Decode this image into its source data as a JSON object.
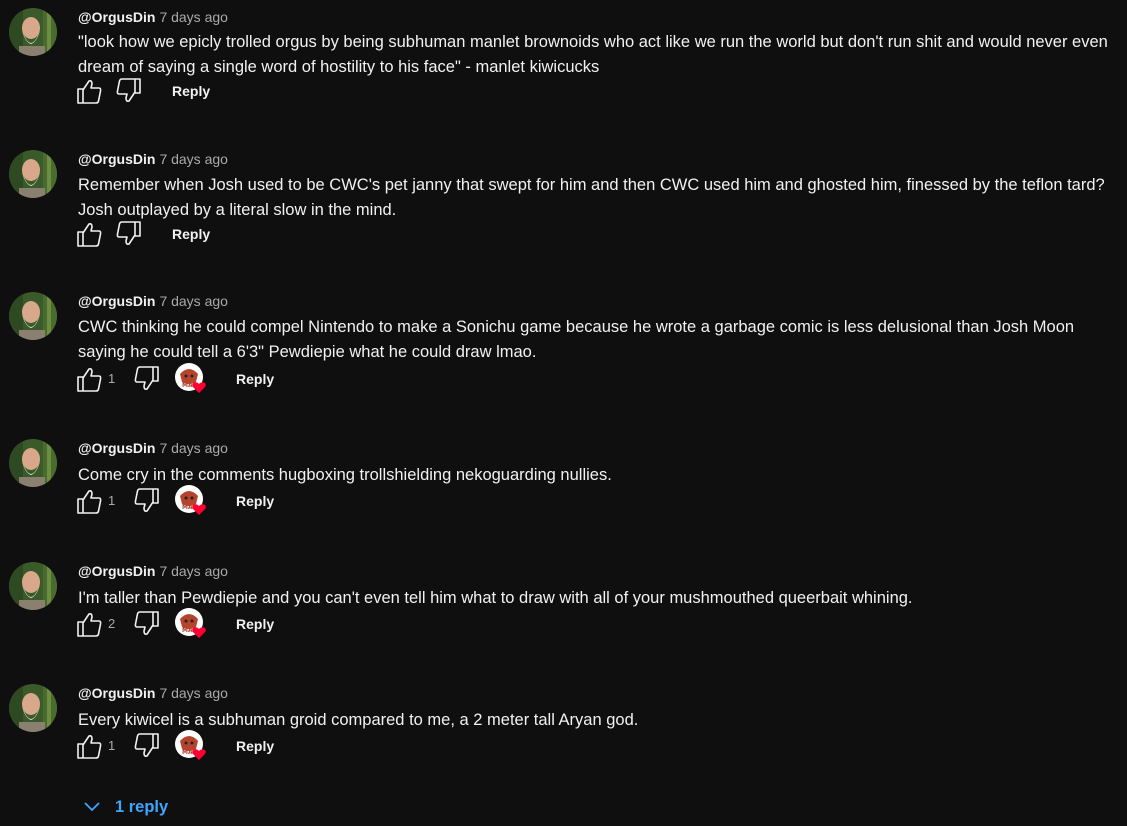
{
  "comments": [
    {
      "author": "@OrgusDin",
      "time": "7 days ago",
      "text": "\"look how we epicly trolled orgus by being subhuman manlet brownoids who act like we run the world but don't run shit and would never even dream of saying a single word of hostility to his face\" - manlet kiwicucks",
      "likes": "",
      "hearted": false,
      "reply_label": "Reply"
    },
    {
      "author": "@OrgusDin",
      "time": "7 days ago",
      "text": "Remember when Josh used to be CWC's pet janny that swept for him and then CWC used him and ghosted him, finessed by the teflon tard? Josh outplayed by a literal slow in the mind.",
      "likes": "",
      "hearted": false,
      "reply_label": "Reply"
    },
    {
      "author": "@OrgusDin",
      "time": "7 days ago",
      "text": "CWC thinking he could compel Nintendo to make a Sonichu game because he wrote a garbage comic is less delusional than Josh Moon saying he could tell a 6'3\" Pewdiepie what he could draw lmao.",
      "likes": "1",
      "hearted": true,
      "reply_label": "Reply"
    },
    {
      "author": "@OrgusDin",
      "time": "7 days ago",
      "text": "Come cry in the comments hugboxing trollshielding nekoguarding nullies.",
      "likes": "1",
      "hearted": true,
      "reply_label": "Reply"
    },
    {
      "author": "@OrgusDin",
      "time": "7 days ago",
      "text": "I'm taller than Pewdiepie and you can't even tell him what to draw with all of your mushmouthed queerbait whining.",
      "likes": "2",
      "hearted": true,
      "reply_label": "Reply"
    },
    {
      "author": "@OrgusDin",
      "time": "7 days ago",
      "text": "Every kiwicel is a subhuman groid compared to me, a 2 meter tall Aryan god.",
      "likes": "1",
      "hearted": true,
      "reply_label": "Reply"
    }
  ],
  "replies_toggle": {
    "label": "1 reply",
    "icon": "chevron-down-icon"
  },
  "icons": {
    "like": "thumbs-up-icon",
    "dislike": "thumbs-down-icon",
    "heart": "creator-heart-icon"
  },
  "colors": {
    "background": "#0f0f0f",
    "text": "#f1f1f1",
    "secondary": "#aaaaaa",
    "link": "#3ea6ff",
    "heart": "#ff0033"
  }
}
